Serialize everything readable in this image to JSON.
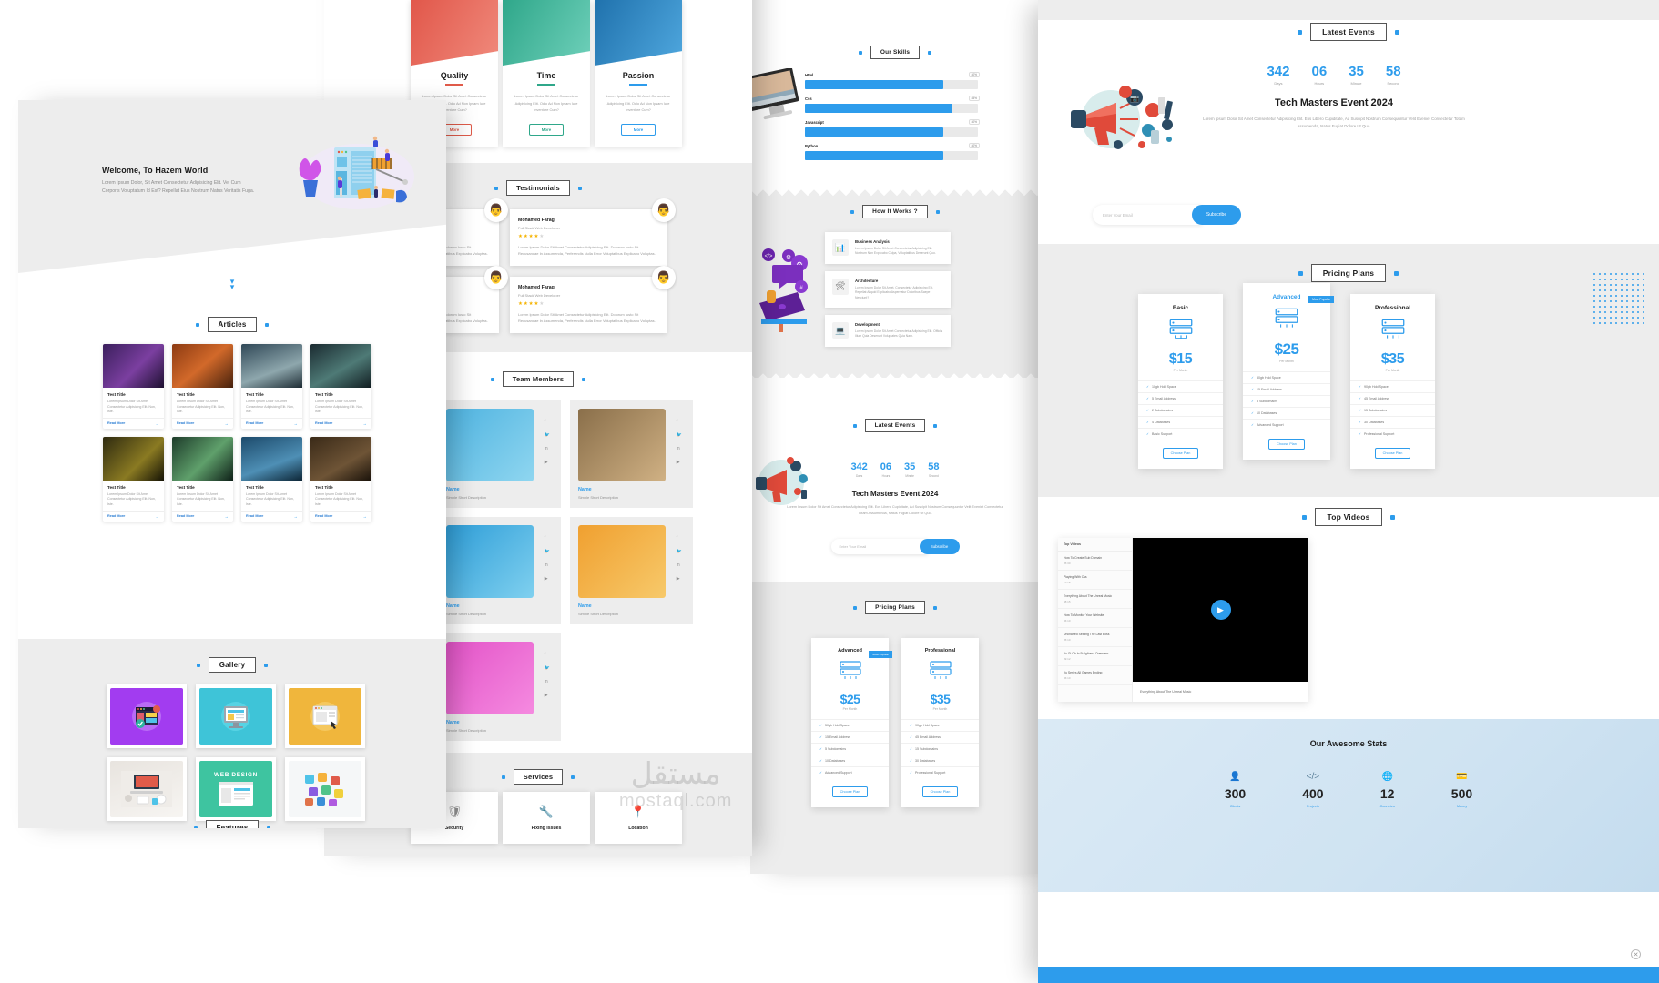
{
  "hero": {
    "title": "Welcome, To Hazem World",
    "paragraph": "Lorem Ipsum Dolor, Sit Amet Consectetur Adipisicing Elit. Vel Cum Corporis Voluptatum Id Est? Repellat Eius Nostrum Natus Veritatis Fuga.",
    "scroll_icon": "chevron-double-down"
  },
  "sections": {
    "articles": "Articles",
    "gallery": "Gallery",
    "features": "Features",
    "testimonials": "Testimonials",
    "team_members": "Team Members",
    "services": "Services",
    "our_skills": "Our Skills",
    "how_it_works": "How It Works ?",
    "latest_events": "Latest Events",
    "pricing_plans": "Pricing Plans",
    "top_videos": "Top Videos",
    "awesome_stats": "Our Awesome Stats"
  },
  "article": {
    "title": "Test Title",
    "desc": "Lorem Ipsum Dolor Sit Amet Consectetur Adipisicing Elit. Non, Iste.",
    "read_more": "Read More",
    "arrow": "right-arrow-icon",
    "cards": [
      {
        "bg": "linear-gradient(135deg,#3a1f5c,#7b3fa0 55%,#1d1030)"
      },
      {
        "bg": "linear-gradient(140deg,#8c3a12,#d2692a 50%,#45200c)"
      },
      {
        "bg": "linear-gradient(160deg,#2f4756,#8ea7ad 60%,#1d2b33)"
      },
      {
        "bg": "linear-gradient(150deg,#1a2a30,#4e7a76 55%,#101c20)"
      },
      {
        "bg": "linear-gradient(135deg,#2e2a10,#8a7a22 60%,#151305)"
      },
      {
        "bg": "linear-gradient(135deg,#1d3b2a,#5fa06b 55%,#0e2018)"
      },
      {
        "bg": "linear-gradient(160deg,#1c4a6b,#4e8fb5 60%,#0d2636)"
      },
      {
        "bg": "linear-gradient(150deg,#3a2a18,#6e5436 60%,#1a120a)"
      }
    ]
  },
  "gallery": {
    "items": [
      {
        "name": "gallery-browser-purple",
        "bg": "#a23cf0",
        "inner": "#b96bf5"
      },
      {
        "name": "gallery-monitor-teal",
        "bg": "#3ec4d8",
        "inner": "#57d3e4"
      },
      {
        "name": "gallery-window-yellow",
        "bg": "#f0b63c",
        "inner": "#f5c85f"
      },
      {
        "name": "gallery-desk-photo",
        "bg": "#e8e4df",
        "inner": "#f2efec"
      },
      {
        "name": "gallery-web-design",
        "bg": "#3ec4a0",
        "inner": "#54d2b0"
      },
      {
        "name": "gallery-icons-collage",
        "bg": "#f0f3f4",
        "inner": "#ffffff"
      }
    ],
    "web_design_label": "WEB DESIGN"
  },
  "qtp": {
    "paragraph": "Lorem Ipsum Dolor Sit Amet Consectetur Adipisicing Elit. Odio Ad Non Ipsam Iure Inventore Cum?",
    "more_label": "More",
    "cards": [
      {
        "title": "Quality",
        "color": "#e05b4a",
        "img": "linear-gradient(120deg,#e1574a,#f08a7c)"
      },
      {
        "title": "Time",
        "color": "#2fa78a",
        "img": "linear-gradient(120deg,#2fa78a,#6fd0ba)"
      },
      {
        "title": "Passion",
        "color": "#2d9cec",
        "img": "linear-gradient(120deg,#2072ad,#4fa7de)"
      }
    ]
  },
  "testimonials": {
    "name": "Mohamed Farag",
    "role": "Full Stack Web Developer",
    "quote": "Lorem Ipsum Dolor Sit Amet Consectetur Adipisicing Elit. Dolorum Iusto Sit Recusandae In Assumenda, Perferendis Nulla Error Voluptatibus Explicabo Voluptas.",
    "stars_filled": 4,
    "stars_total": 5,
    "avatar_icon": "person-avatar"
  },
  "team": {
    "name": "Name",
    "desc": "Simple Short Description",
    "socials": [
      "facebook-icon",
      "twitter-icon",
      "linkedin-icon",
      "youtube-icon"
    ],
    "members": [
      {
        "bg": "linear-gradient(135deg,#1a86d6,#4fb0ea)"
      },
      {
        "bg": "linear-gradient(135deg,#4fb3e0,#8fd6f0)"
      },
      {
        "bg": "linear-gradient(135deg,#8a6f4a,#d0b184)"
      },
      {
        "bg": "linear-gradient(135deg,#d03a3a,#ef7a6a)"
      },
      {
        "bg": "linear-gradient(135deg,#2f9ed8,#7fd0ef)"
      },
      {
        "bg": "linear-gradient(135deg,#f0a030,#f7c96a)"
      },
      {
        "bg": "linear-gradient(135deg,#e8a04a,#f5cb8a)"
      },
      {
        "bg": "linear-gradient(135deg,#e354c8,#f58ae0)"
      }
    ]
  },
  "services": [
    {
      "title": "Security",
      "icon": "shield-icon"
    },
    {
      "title": "Fixing Issues",
      "icon": "wrench-icon"
    },
    {
      "title": "Location",
      "icon": "map-pin-icon"
    }
  ],
  "skills": [
    {
      "name": "Html",
      "pct": "80%",
      "value": 80
    },
    {
      "name": "Css",
      "pct": "85%",
      "value": 85
    },
    {
      "name": "Javascript",
      "pct": "80%",
      "value": 80
    },
    {
      "name": "Python",
      "pct": "80%",
      "value": 80
    }
  ],
  "how_it_works": [
    {
      "title": "Business Analysis",
      "desc": "Lorem Ipsum Dolor Sit Amet Consectetur Adipisicing Elit. Nostrum Non Explicabo Culpa, Voluptatibus Deserunt Quo.",
      "icon": "analysis-icon"
    },
    {
      "title": "Architecture",
      "desc": "Lorem Ipsum Dolor Sit Amet, Consectetur Adipisicing Elit. Repellat Aliquid Explicabo Aspernatur Doloribus Saepe Nesciunt?",
      "icon": "architecture-icon"
    },
    {
      "title": "Development",
      "desc": "Lorem Ipsum Dolor Sit Amet Consectetur Adipisicing Elit. Officiis Illum Quia Deserunt Voluptates Quia Nam.",
      "icon": "development-icon"
    }
  ],
  "event": {
    "title": "Tech Masters Event 2024",
    "desc": "Lorem Ipsum Dolor Sit Amet Consectetur Adipisicing Elit. Eos Libero Cupiditate, Ad Suscipit Nostrum Consequuntur Velit Eveniet Consectetur Totam Assumenda, Natus Fugiat Dolore Ut Quo.",
    "countdown": [
      {
        "value": "342",
        "label": "Days"
      },
      {
        "value": "06",
        "label": "Hours"
      },
      {
        "value": "35",
        "label": "Minute"
      },
      {
        "value": "58",
        "label": "Second"
      }
    ],
    "email_placeholder": "Enter Your Email",
    "subscribe_label": "Subscribe",
    "illustration": "megaphone-marketing-icon"
  },
  "pricing": {
    "popular_ribbon": "Most Popular",
    "choose_label": "Choose Plan",
    "per_month": "Per Month",
    "plans": [
      {
        "name": "Basic",
        "price": "$15",
        "features": [
          "10gb Hdd Space",
          "5 Email Address",
          "2 Subdomains",
          "4 Databases",
          "Basic Support"
        ]
      },
      {
        "name": "Advanced",
        "price": "$25",
        "features": [
          "50gb Hdd Space",
          "15 Email Address",
          "5 Subdomains",
          "10 Databases",
          "Advanced Support"
        ]
      },
      {
        "name": "Professional",
        "price": "$35",
        "features": [
          "90gb Hdd Space",
          "45 Email Address",
          "15 Subdomains",
          "30 Databases",
          "Professional Support"
        ]
      }
    ],
    "server_icon": "server-rack-icon"
  },
  "videos": {
    "list_header": "Top Videos",
    "play_icon": "play-button-icon",
    "caption": "Everything About The Unreal Music",
    "items": [
      {
        "title": "How To Create Sub Domain",
        "dur": "05:30"
      },
      {
        "title": "Playing With Css",
        "dur": "10:18"
      },
      {
        "title": "Everything About The Unreal Music",
        "dur": "08:15"
      },
      {
        "title": "How To Monitor Your Website",
        "dur": "06:10"
      },
      {
        "title": "Uncharted Sealing The Last Boss",
        "dur": "05:10"
      },
      {
        "title": "Yu Gi Oh In Fullgihana Overview",
        "dur": "09:12"
      },
      {
        "title": "Yu Series All Games Ending",
        "dur": "06:10"
      }
    ]
  },
  "stats": [
    {
      "value": "300",
      "label": "Clients",
      "icon": "user-icon"
    },
    {
      "value": "400",
      "label": "Projects",
      "icon": "code-icon"
    },
    {
      "value": "12",
      "label": "Countries",
      "icon": "globe-icon"
    },
    {
      "value": "500",
      "label": "Money",
      "icon": "wallet-icon"
    }
  ],
  "watermark": {
    "arabic": "مستقل",
    "latin": "mostaql.com"
  },
  "colors": {
    "accent": "#2d9cec",
    "dark": "#1c1c1c",
    "muted": "#9a9a9a",
    "panel_grey": "#ededed"
  }
}
